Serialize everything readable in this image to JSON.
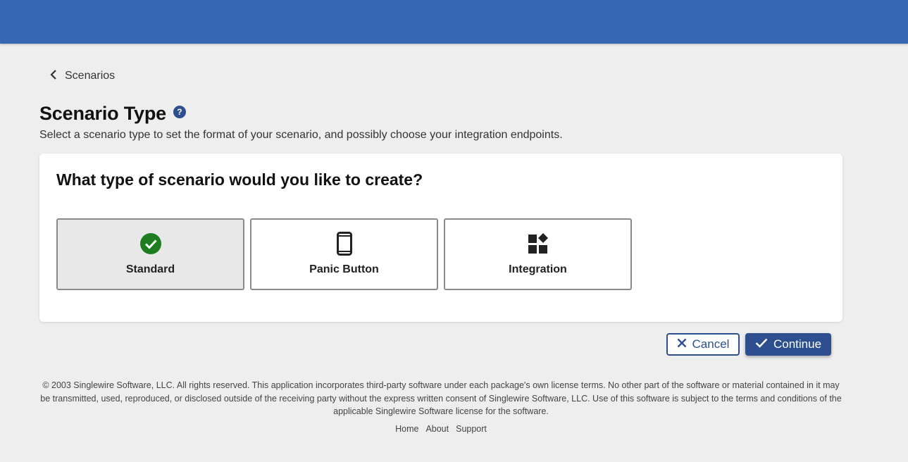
{
  "header": {
    "color": "#3567b4"
  },
  "breadcrumb": {
    "label": "Scenarios",
    "icon": "chevron-left-icon"
  },
  "page": {
    "title": "Scenario Type",
    "help_icon": "?",
    "subtitle": "Select a scenario type to set the format of your scenario, and possibly choose your integration endpoints."
  },
  "card": {
    "question": "What type of scenario would you like to create?",
    "options": [
      {
        "label": "Standard",
        "icon": "check-circle-icon",
        "selected": true
      },
      {
        "label": "Panic Button",
        "icon": "mobile-phone-icon",
        "selected": false
      },
      {
        "label": "Integration",
        "icon": "widgets-icon",
        "selected": false
      }
    ]
  },
  "actions": {
    "cancel_label": "Cancel",
    "continue_label": "Continue"
  },
  "footer": {
    "legal": "© 2003 Singlewire Software, LLC. All rights reserved. This application incorporates third-party software under each package's own license terms. No other part of the software or material contained in it may be transmitted, used, reproduced, or disclosed outside of the receiving party without the express written consent of Singlewire Software, LLC. Use of this software is subject to the terms and conditions of the applicable Singlewire Software license for the software.",
    "links": [
      "Home",
      "About",
      "Support"
    ]
  },
  "colors": {
    "primary": "#2d4f8f",
    "success": "#1e7d1e",
    "background": "#eeeeee"
  }
}
